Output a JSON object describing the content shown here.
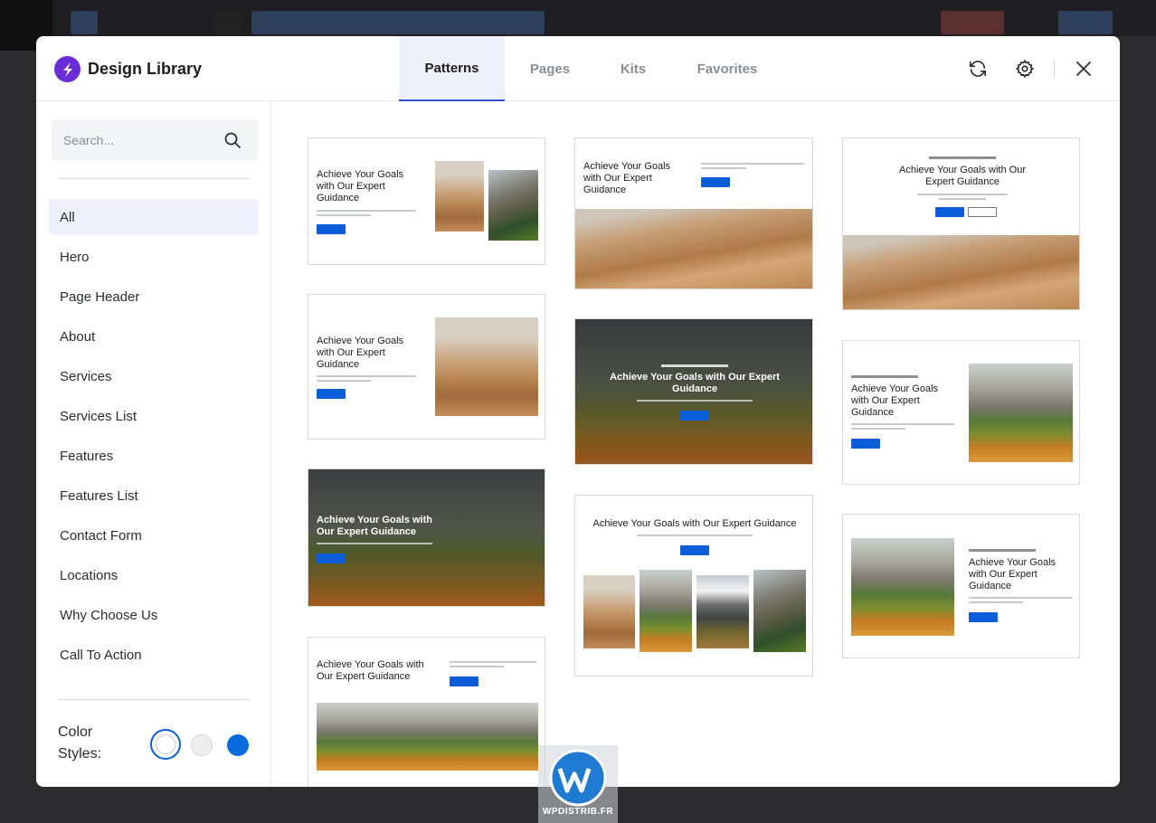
{
  "brand": {
    "title": "Design Library",
    "accent": "#6b2bd9"
  },
  "tabs": [
    {
      "label": "Patterns",
      "active": true
    },
    {
      "label": "Pages",
      "active": false
    },
    {
      "label": "Kits",
      "active": false
    },
    {
      "label": "Favorites",
      "active": false
    }
  ],
  "header_icons": [
    "refresh-icon",
    "gear-icon",
    "close-icon"
  ],
  "search": {
    "placeholder": "Search..."
  },
  "categories": [
    {
      "label": "All",
      "active": true
    },
    {
      "label": "Hero"
    },
    {
      "label": "Page Header"
    },
    {
      "label": "About"
    },
    {
      "label": "Services"
    },
    {
      "label": "Services List"
    },
    {
      "label": "Features"
    },
    {
      "label": "Features List"
    },
    {
      "label": "Contact Form"
    },
    {
      "label": "Locations"
    },
    {
      "label": "Why Choose Us"
    },
    {
      "label": "Call To Action"
    }
  ],
  "color_styles": {
    "label": "Color Styles:",
    "swatches": [
      "#ffffff",
      "#eeeeee",
      "#0b6bde"
    ],
    "selected": 0
  },
  "patterns": {
    "heading": "Achieve Your Goals with Our Expert Guidance",
    "kicker": "EMPOWERING SUCCESS TOGETHER",
    "button_color": "#0b5ed7"
  },
  "watermark": {
    "text": "WPDISTRIB.FR"
  }
}
